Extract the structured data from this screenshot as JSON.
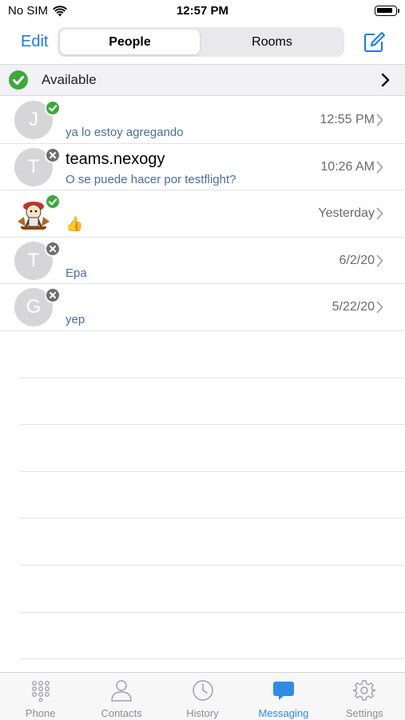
{
  "status_bar": {
    "carrier": "No SIM",
    "time": "12:57 PM"
  },
  "nav": {
    "edit_label": "Edit",
    "segments": [
      "People",
      "Rooms"
    ],
    "selected_segment": "People"
  },
  "availability": {
    "label": "Available",
    "color": "#3ea83e"
  },
  "conversations": [
    {
      "initial": "J",
      "name": "",
      "message": "ya lo estoy agregando",
      "time": "12:55 PM",
      "status": "online"
    },
    {
      "initial": "T",
      "name": "teams.nexogy",
      "message": "O se puede hacer por testflight?",
      "time": "10:26 AM",
      "status": "offline"
    },
    {
      "initial": "",
      "name": "",
      "message": "👍",
      "time": "Yesterday",
      "status": "online",
      "avatar_image": "cartoon-avatar"
    },
    {
      "initial": "T",
      "name": "",
      "message": "Epa",
      "time": "6/2/20",
      "status": "offline"
    },
    {
      "initial": "G",
      "name": "",
      "message": "yep",
      "time": "5/22/20",
      "status": "offline"
    }
  ],
  "tabs": [
    {
      "label": "Phone",
      "icon": "keypad-icon"
    },
    {
      "label": "Contacts",
      "icon": "person-icon"
    },
    {
      "label": "History",
      "icon": "clock-icon"
    },
    {
      "label": "Messaging",
      "icon": "chat-bubble-icon",
      "active": true
    },
    {
      "label": "Settings",
      "icon": "gear-icon"
    }
  ],
  "colors": {
    "accent": "#1a7be5",
    "online": "#3ea83e",
    "offline": "#6e6e72",
    "message_text": "#4a6ea0"
  }
}
